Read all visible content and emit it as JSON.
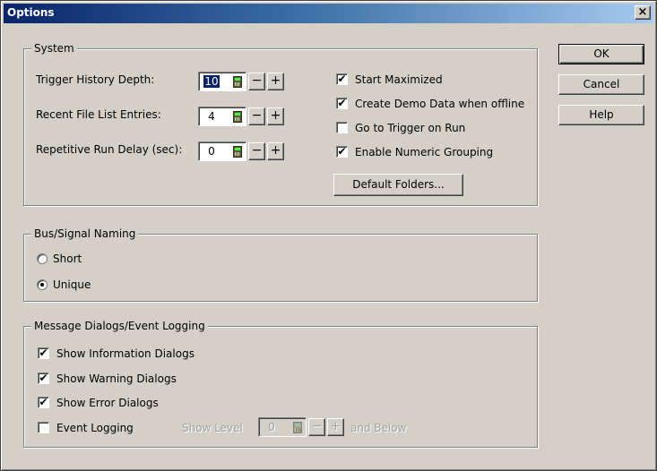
{
  "window": {
    "title": "Options",
    "close_glyph": "×"
  },
  "buttons": {
    "ok": "OK",
    "cancel": "Cancel",
    "help": "Help",
    "default_folders": "Default Folders..."
  },
  "system": {
    "legend": "System",
    "fields": [
      {
        "label": "Trigger History Depth:",
        "value": "10",
        "selected": true
      },
      {
        "label": "Recent File List Entries:",
        "value": "4"
      },
      {
        "label": "Repetitive Run Delay (sec):",
        "value": "0"
      }
    ],
    "spin_minus": "−",
    "spin_plus": "+",
    "options": [
      {
        "label": "Start Maximized",
        "checked": true
      },
      {
        "label": "Create Demo Data when offline",
        "checked": true
      },
      {
        "label": "Go to Trigger on Run",
        "checked": false
      },
      {
        "label": "Enable Numeric Grouping",
        "checked": true
      }
    ]
  },
  "bus_naming": {
    "legend": "Bus/Signal Naming",
    "options": [
      {
        "label": "Short",
        "selected": false
      },
      {
        "label": "Unique",
        "selected": true
      }
    ]
  },
  "messages": {
    "legend": "Message Dialogs/Event Logging",
    "options": [
      {
        "label": "Show Information Dialogs",
        "checked": true
      },
      {
        "label": "Show Warning Dialogs",
        "checked": true
      },
      {
        "label": "Show Error Dialogs",
        "checked": true
      },
      {
        "label": "Event Logging",
        "checked": false
      }
    ],
    "show_level_label": "Show Level",
    "show_level_value": "0",
    "and_below_label": "and Below"
  },
  "check_glyph": "✔"
}
